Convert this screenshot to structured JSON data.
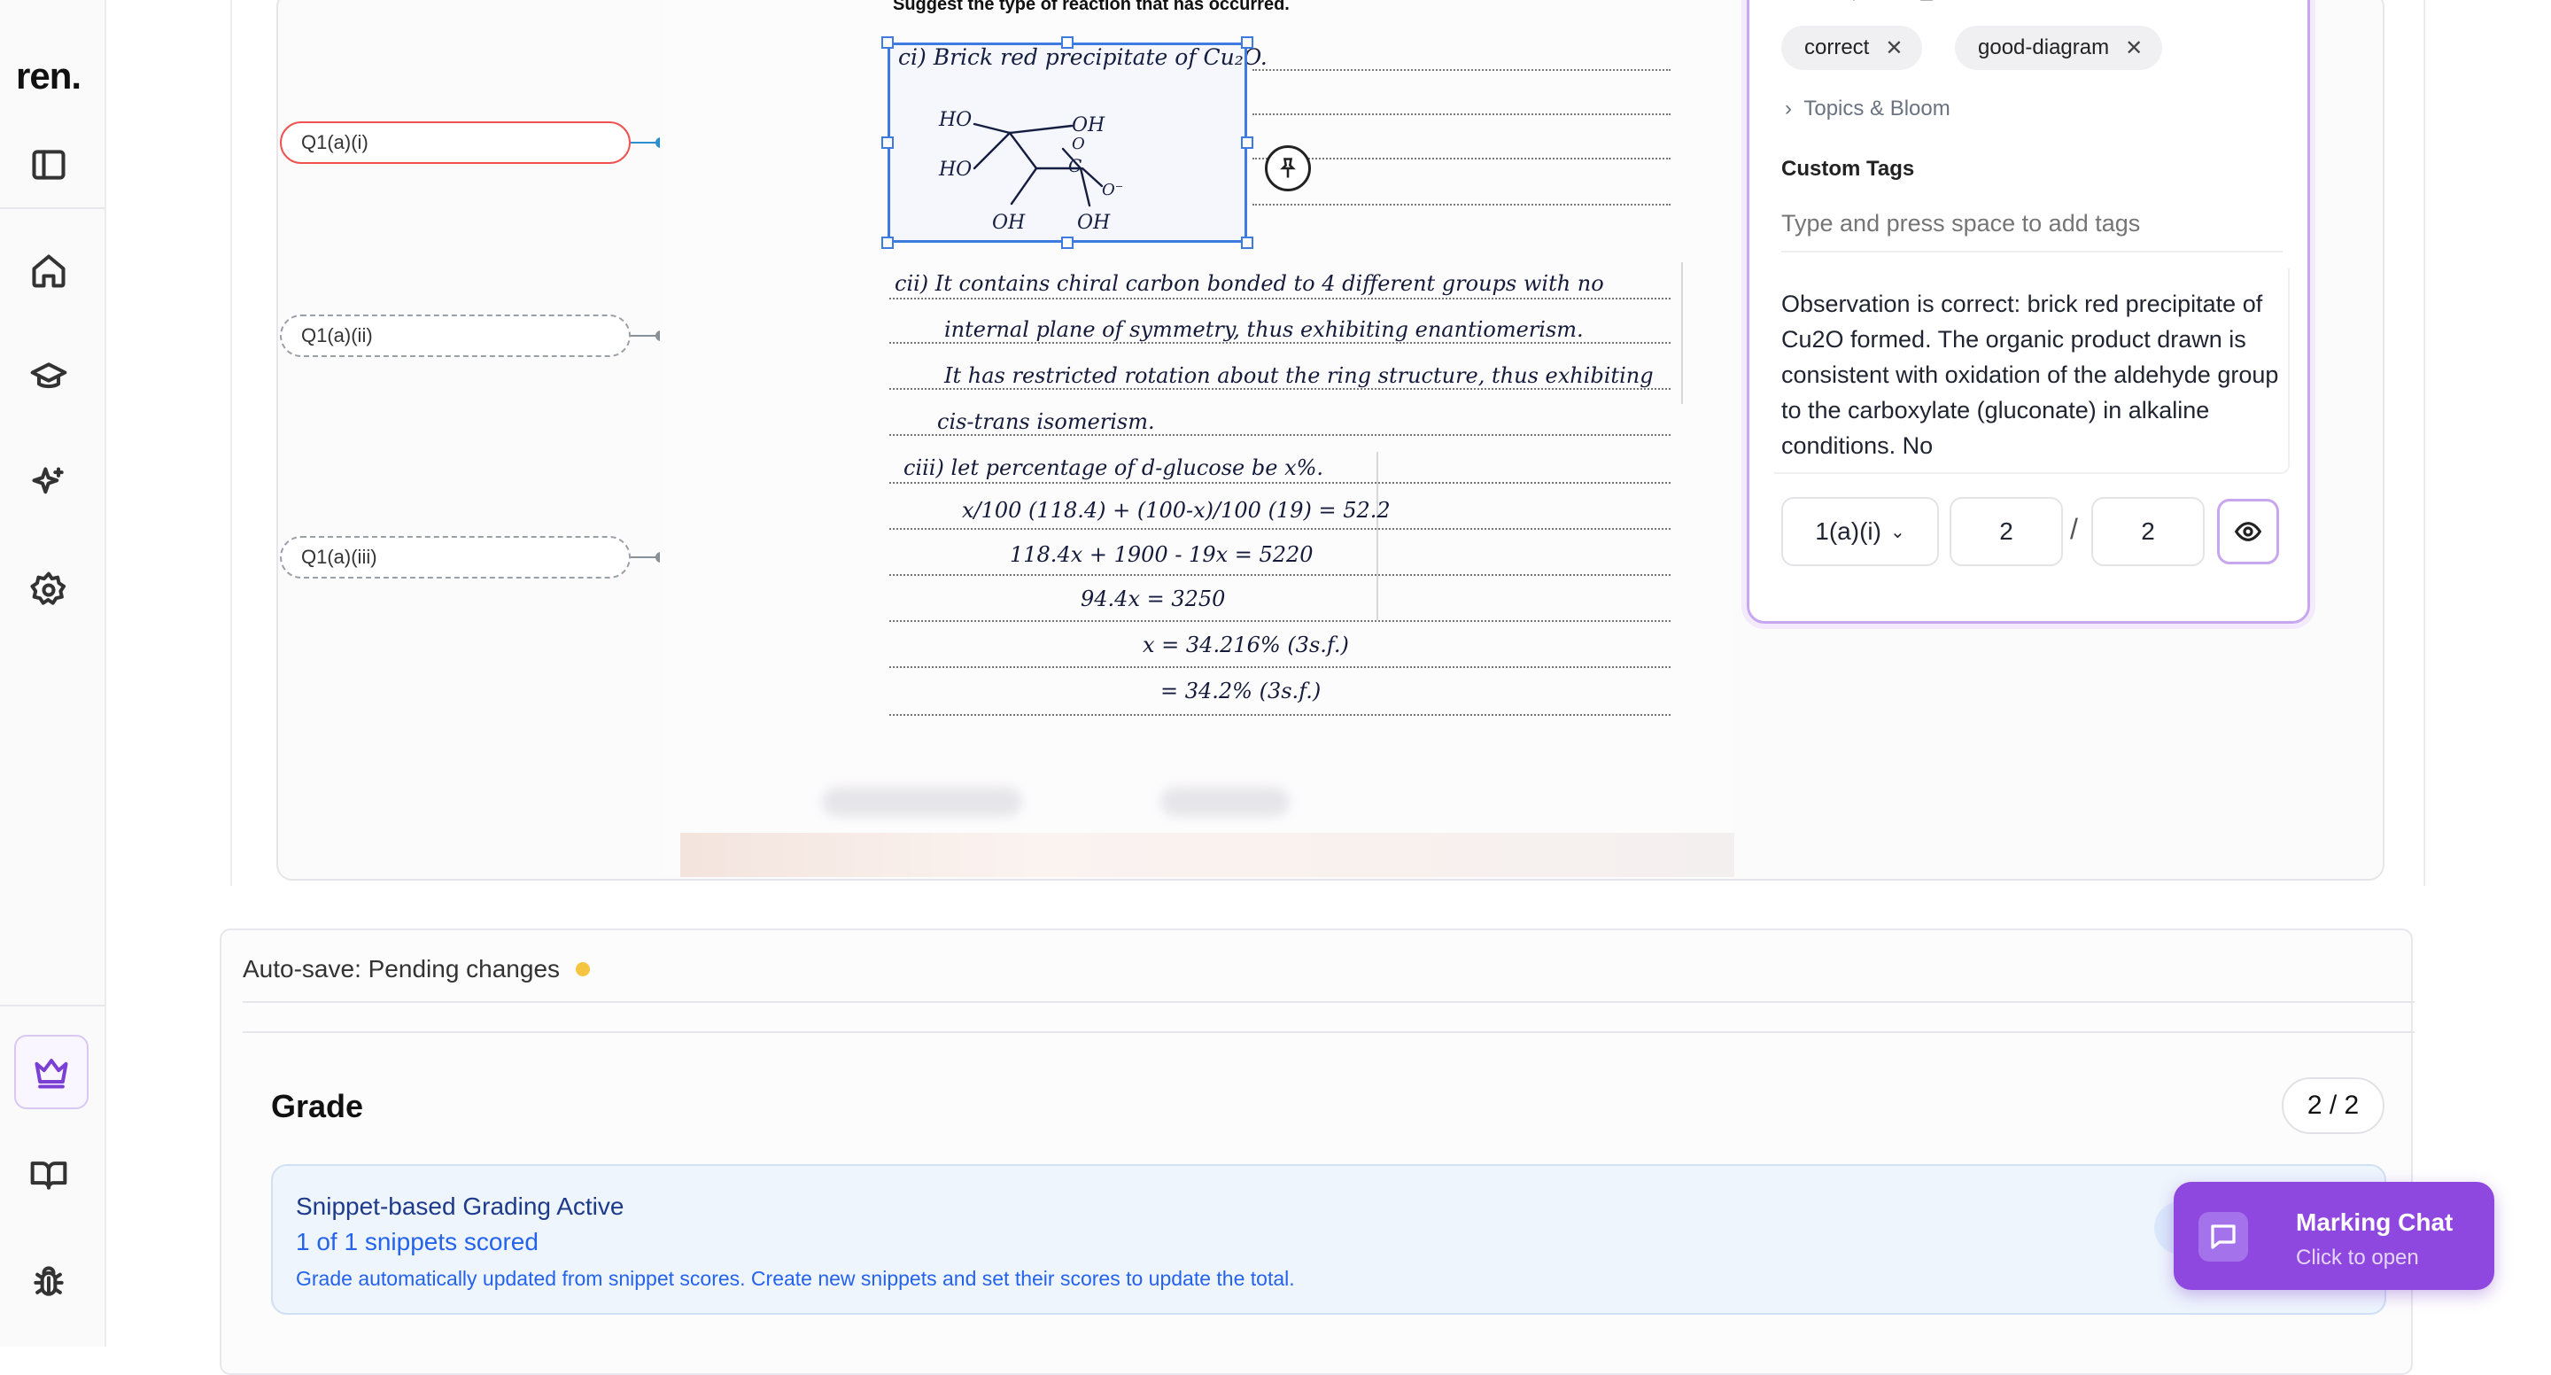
{
  "app": {
    "logo": "ren."
  },
  "sidebar": {
    "items": [
      {
        "name": "sidebar-toggle-icon"
      },
      {
        "name": "home-icon"
      },
      {
        "name": "graduation-cap-icon"
      },
      {
        "name": "sparkles-icon"
      },
      {
        "name": "settings-icon"
      },
      {
        "name": "crown-icon",
        "active": true
      },
      {
        "name": "book-icon"
      },
      {
        "name": "bug-icon"
      }
    ]
  },
  "questions": [
    {
      "label": "Q1(a)(i)",
      "state": "active"
    },
    {
      "label": "Q1(a)(ii)",
      "state": "inactive"
    },
    {
      "label": "Q1(a)(iii)",
      "state": "inactive"
    }
  ],
  "script": {
    "question_text": "Suggest the type of reaction that has occurred.",
    "lines": [
      "ci) Brick red precipitate of Cu₂O.",
      "cii) It contains chiral carbon bonded to 4 different groups with no",
      "internal plane of symmetry, thus exhibiting enantiomerism.",
      "It has restricted rotation about the ring structure, thus exhibiting",
      "cis-trans isomerism.",
      "ciii) let percentage of d-glucose be x%.",
      "x/100 (118.4) + (100-x)/100 (19) = 52.2",
      "118.4x + 1900 - 19x = 5220",
      "94.4x = 3250",
      "x = 34.216% (3s.f.)",
      "= 34.2% (3s.f.)"
    ],
    "diagram_labels": [
      "HO",
      "HO",
      "OH",
      "OH",
      "OH",
      "C",
      "O",
      "O⁻"
    ]
  },
  "annotation_card": {
    "tags": [
      "correct",
      "good-diagram"
    ],
    "topics_label": "Topics & Bloom",
    "custom_tags_label": "Custom Tags",
    "custom_tags_placeholder": "Type and press space to add tags",
    "feedback": "Observation is correct: brick red precipitate of Cu2O formed. The organic product drawn is consistent with oxidation of the aldehyde group to the carboxylate (gluconate) in alkaline conditions. No",
    "question_select": "1(a)(i)",
    "score": "2",
    "max_score": "2",
    "score_separator": "/"
  },
  "autosave": {
    "text": "Auto-save: Pending changes"
  },
  "grade": {
    "title": "Grade",
    "badge": "2 / 2",
    "snippet_title": "Snippet-based Grading Active",
    "snippet_count": "1 of 1 snippets scored",
    "snippet_desc": "Grade automatically updated from snippet scores. Create new snippets and set their scores to update the total."
  },
  "chat": {
    "title": "Marking Chat",
    "subtitle": "Click to open"
  },
  "colors": {
    "accent": "#8e48e0",
    "active_question": "#ef5350",
    "selection": "#3d7be0",
    "info_bg": "#eef5fd",
    "pending_dot": "#f5c542"
  }
}
